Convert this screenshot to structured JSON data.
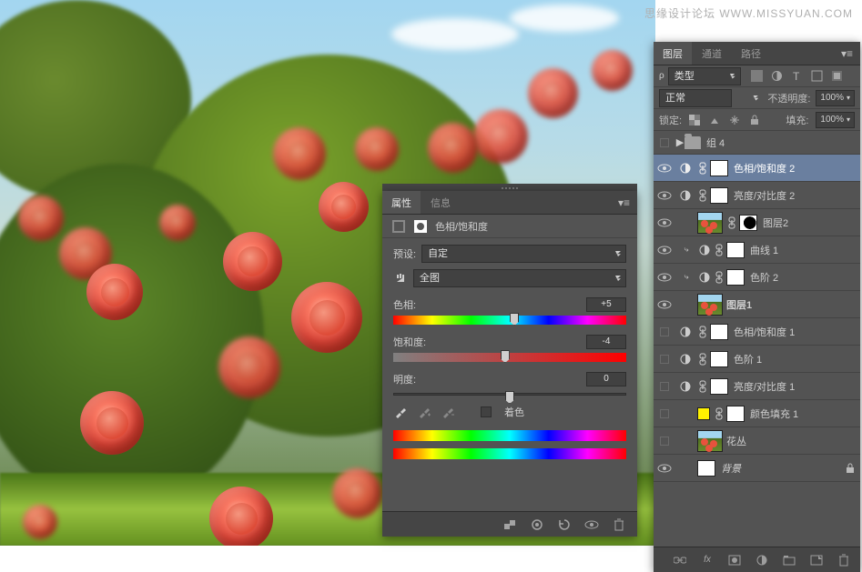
{
  "watermark": "思缘设计论坛  WWW.MISSYUAN.COM",
  "properties": {
    "tabs": {
      "properties": "属性",
      "info": "信息"
    },
    "title": "色相/饱和度",
    "preset_label": "预设:",
    "preset_value": "自定",
    "range_value": "全图",
    "hue_label": "色相:",
    "hue_value": "+5",
    "sat_label": "饱和度:",
    "sat_value": "-4",
    "lig_label": "明度:",
    "lig_value": "0",
    "colorize": "着色"
  },
  "layers_panel": {
    "tabs": {
      "layers": "图层",
      "channels": "通道",
      "paths": "路径"
    },
    "kind": "类型",
    "blend": "正常",
    "opacity_label": "不透明度:",
    "opacity_value": "100%",
    "lock_label": "锁定:",
    "fill_label": "填充:",
    "fill_value": "100%",
    "layers": {
      "group4": "组 4",
      "hue2": "色相/饱和度 2",
      "bc2": "亮度/对比度 2",
      "layer2": "图层2",
      "curves1": "曲线 1",
      "levels2": "色阶 2",
      "layer1": "图层1",
      "hue1": "色相/饱和度 1",
      "levels1": "色阶 1",
      "bc1": "亮度/对比度 1",
      "colorfill1": "颜色填充 1",
      "flowers": "花丛",
      "background": "背景"
    }
  }
}
